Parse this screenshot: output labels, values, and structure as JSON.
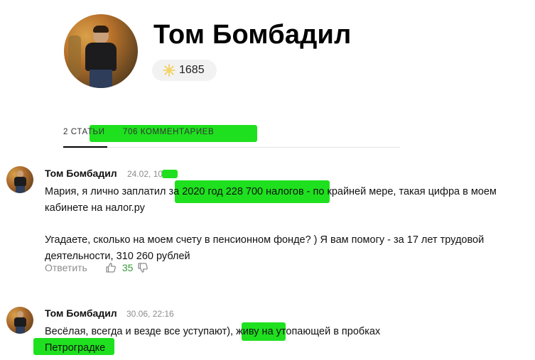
{
  "profile": {
    "name": "Том Бомбадил",
    "karma": "1685"
  },
  "tabs": [
    {
      "label": "2 статьи"
    },
    {
      "label": "706 комментариев"
    }
  ],
  "comments": [
    {
      "author": "Том Бомбадил",
      "date": "24.02, 10:56",
      "paragraphs": [
        "Мария, я лично заплатил за 2020 год 228 700 налогов - по крайней мере, такая цифра в моем кабинете на налог.ру",
        "Угадаете, сколько на моем счету в пенсионном фонде? ) Я вам помогу - за 17 лет трудовой деятельности, 310 260 рублей"
      ],
      "reply_label": "Ответить",
      "likes": "35"
    },
    {
      "author": "Том Бомбадил",
      "date": "30.06, 22:16",
      "paragraphs": [
        "Весёлая, всегда и везде все уступают), живу на утопающей в пробках Петроградке"
      ]
    }
  ],
  "colors": {
    "highlight": "#1fe01f",
    "likes": "#3a9a3a",
    "muted": "#8c8c8c"
  },
  "icons": [
    "karma-sun-icon",
    "thumbs-up-icon",
    "thumbs-down-icon"
  ]
}
